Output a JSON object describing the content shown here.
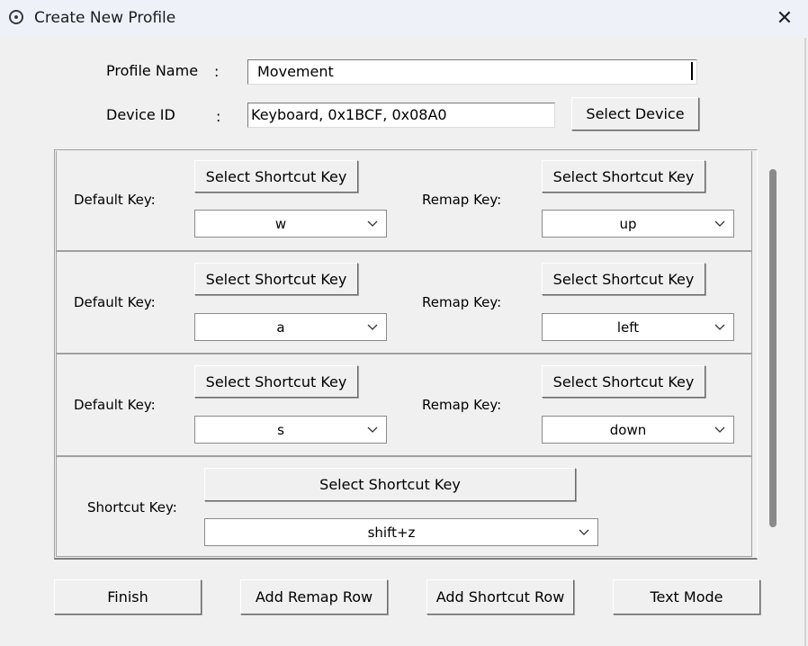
{
  "window": {
    "title": "Create New Profile",
    "close_label": "✕"
  },
  "profile": {
    "name_label": "Profile Name",
    "colon": ":",
    "name_value": "Movement",
    "device_label": "Device ID",
    "device_value": "Keyboard, 0x1BCF, 0x08A0",
    "select_device_label": "Select Device"
  },
  "rows": [
    {
      "default_label": "Default Key:",
      "default_button": "Select Shortcut Key",
      "default_value": "w",
      "remap_label": "Remap Key:",
      "remap_button": "Select Shortcut Key",
      "remap_value": "up"
    },
    {
      "default_label": "Default Key:",
      "default_button": "Select Shortcut Key",
      "default_value": "a",
      "remap_label": "Remap Key:",
      "remap_button": "Select Shortcut Key",
      "remap_value": "left"
    },
    {
      "default_label": "Default Key:",
      "default_button": "Select Shortcut Key",
      "default_value": "s",
      "remap_label": "Remap Key:",
      "remap_button": "Select Shortcut Key",
      "remap_value": "down"
    }
  ],
  "shortcut_row": {
    "label": "Shortcut Key:",
    "button": "Select Shortcut Key",
    "value": "shift+z"
  },
  "footer": {
    "finish": "Finish",
    "add_remap_row": "Add Remap Row",
    "add_shortcut_row": "Add Shortcut Row",
    "text_mode": "Text Mode"
  },
  "icons": {
    "app": "app-icon",
    "close": "close-icon",
    "dropdown": "chevron-down-icon"
  }
}
